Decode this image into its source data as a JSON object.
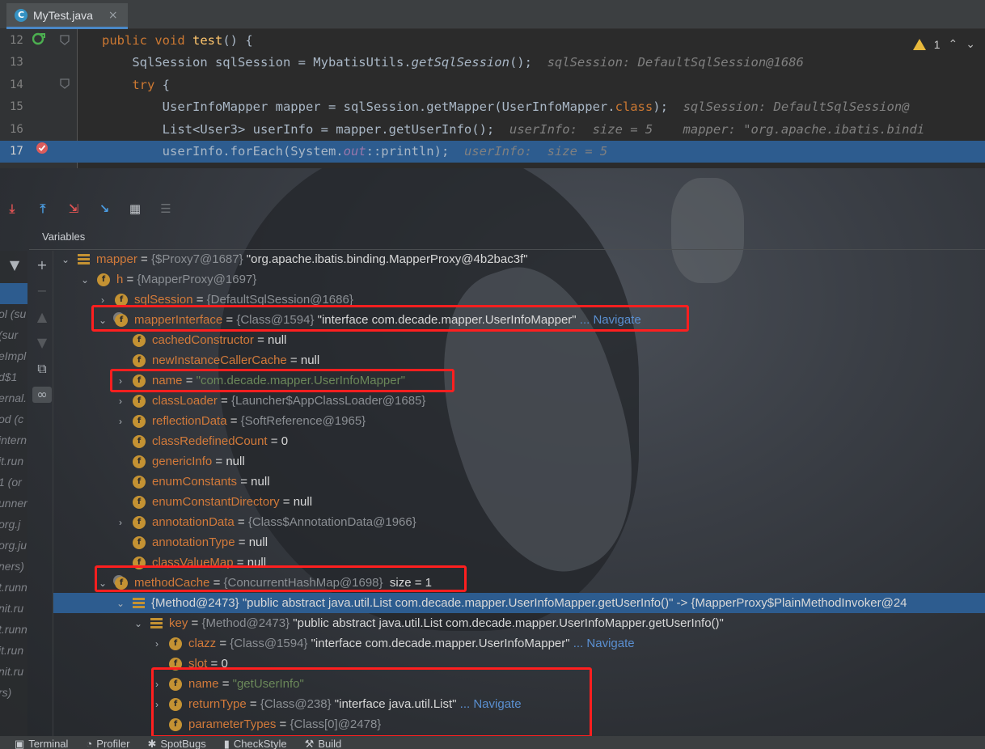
{
  "tab": {
    "icon": "C",
    "label": "MyTest.java",
    "close": "×"
  },
  "editor": {
    "warning_count": "1",
    "lines": [
      {
        "n": "12",
        "segments": [
          [
            "kw",
            "public "
          ],
          [
            "kw",
            "void "
          ],
          [
            "fn",
            "test"
          ],
          [
            "pl",
            "() {"
          ]
        ]
      },
      {
        "n": "13",
        "segments": [
          [
            "pl",
            "    SqlSession sqlSession = MybatisUtils."
          ],
          [
            "it",
            "getSqlSession"
          ],
          [
            "pl",
            "();"
          ],
          [
            "kw",
            ""
          ],
          [
            "inl",
            "  sqlSession: DefaultSqlSession@1686"
          ]
        ]
      },
      {
        "n": "14",
        "segments": [
          [
            "kw",
            "    try "
          ],
          [
            "pl",
            "{"
          ]
        ]
      },
      {
        "n": "15",
        "segments": [
          [
            "pl",
            "        UserInfoMapper mapper = sqlSession.getMapper(UserInfoMapper."
          ],
          [
            "kw",
            "class"
          ],
          [
            "pl",
            ");"
          ],
          [
            "inl",
            "  sqlSession: DefaultSqlSession@"
          ]
        ]
      },
      {
        "n": "16",
        "segments": [
          [
            "pl",
            "        List<User3> userInfo = mapper.getUserInfo();"
          ],
          [
            "inl",
            "  userInfo:  size = 5    mapper: \"org.apache.ibatis.bindi"
          ]
        ]
      },
      {
        "n": "17",
        "segments": [
          [
            "pl",
            "        userInfo.forEach(System."
          ],
          [
            "fld",
            "out"
          ],
          [
            "pl",
            "::println);"
          ],
          [
            "inl",
            "  userInfo:  size = 5"
          ]
        ]
      }
    ]
  },
  "debug": {
    "panel_title": "Variables"
  },
  "frames": [
    "ol (su",
    "(sur",
    "eImpl",
    "d$1",
    "ernal.",
    "od (c",
    "intern",
    "it.run",
    "1 (or",
    "unner",
    "org.j",
    "org.ju",
    "ners)",
    "t.runn",
    "nit.ru",
    "t.runn",
    "it.run",
    "nit.ru",
    "rs)"
  ],
  "tree": [
    {
      "name": "mapper",
      "type": "{$Proxy7@1687}",
      "str": "\"org.apache.ibatis.binding.MapperProxy@4b2bac3f\""
    },
    {
      "name": "h",
      "type": "{MapperProxy@1697}"
    },
    {
      "name": "sqlSession",
      "type": "{DefaultSqlSession@1686}"
    },
    {
      "name": "mapperInterface",
      "type": "{Class@1594}",
      "str": "\"interface com.decade.mapper.UserInfoMapper\"",
      "nav": "... Navigate"
    },
    {
      "name": "cachedConstructor",
      "val": "null"
    },
    {
      "name": "newInstanceCallerCache",
      "val": "null"
    },
    {
      "name": "name",
      "str": "\"com.decade.mapper.UserInfoMapper\""
    },
    {
      "name": "classLoader",
      "type": "{Launcher$AppClassLoader@1685}"
    },
    {
      "name": "reflectionData",
      "type": "{SoftReference@1965}"
    },
    {
      "name": "classRedefinedCount",
      "val": "0"
    },
    {
      "name": "genericInfo",
      "val": "null"
    },
    {
      "name": "enumConstants",
      "val": "null"
    },
    {
      "name": "enumConstantDirectory",
      "val": "null"
    },
    {
      "name": "annotationData",
      "type": "{Class$AnnotationData@1966}"
    },
    {
      "name": "annotationType",
      "val": "null"
    },
    {
      "name": "classValueMap",
      "val": "null"
    },
    {
      "name": "methodCache",
      "type": "{ConcurrentHashMap@1698}",
      "extra": "size = 1"
    },
    {
      "name": "",
      "text": "{Method@2473} \"public abstract java.util.List com.decade.mapper.UserInfoMapper.getUserInfo()\" -> {MapperProxy$PlainMethodInvoker@24"
    },
    {
      "name": "key",
      "type": "{Method@2473}",
      "str": "\"public abstract java.util.List com.decade.mapper.UserInfoMapper.getUserInfo()\""
    },
    {
      "name": "clazz",
      "type": "{Class@1594}",
      "str": "\"interface com.decade.mapper.UserInfoMapper\"",
      "nav": "... Navigate"
    },
    {
      "name": "slot",
      "val": "0"
    },
    {
      "name": "name",
      "str": "\"getUserInfo\""
    },
    {
      "name": "returnType",
      "type": "{Class@238}",
      "str": "\"interface java.util.List\"",
      "nav": "... Navigate"
    },
    {
      "name": "parameterTypes",
      "type": "{Class[0]@2478}"
    }
  ],
  "bottom": [
    "Terminal",
    "Profiler",
    "SpotBugs",
    "CheckStyle",
    "Build"
  ],
  "colors": {
    "accent": "#2d5c8f",
    "highlight_box": "#ff1f1f",
    "field_icon": "#c49233"
  }
}
